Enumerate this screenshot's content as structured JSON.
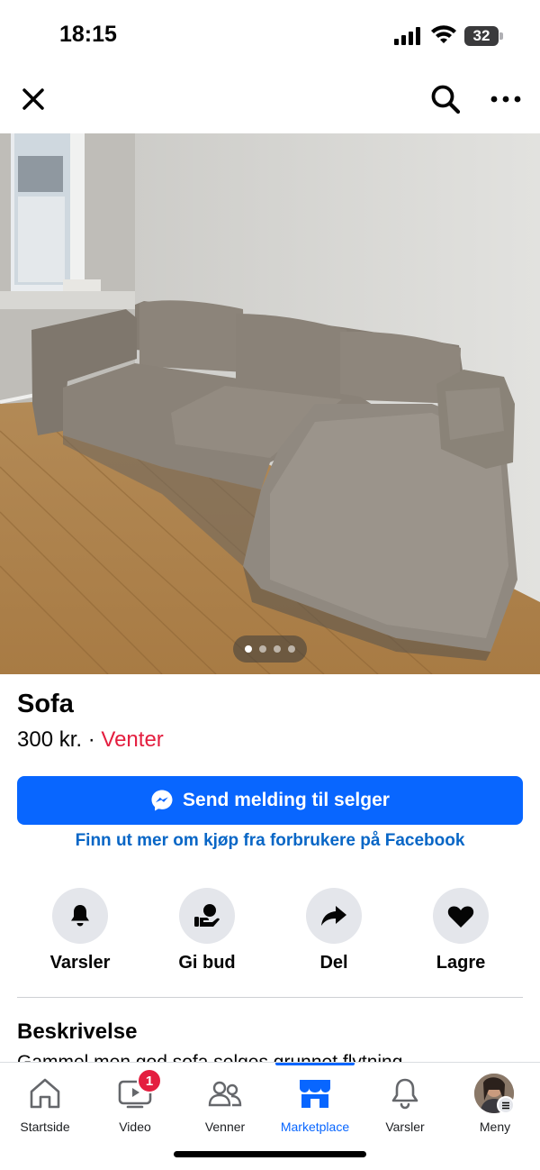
{
  "status_bar": {
    "time": "18:15",
    "battery": "32"
  },
  "top_nav": {
    "close_icon": "close-icon",
    "search_icon": "search-icon",
    "more_icon": "more-icon"
  },
  "photo": {
    "description_icon": "sofa-photo",
    "page_count": 4,
    "current_page": 1
  },
  "listing": {
    "title": "Sofa",
    "price": "300 kr.",
    "separator": "·",
    "status": "Venter",
    "status_color": "#e41e3f"
  },
  "primary_button": {
    "label": "Send melding til selger",
    "icon": "messenger-icon",
    "color": "#0866ff"
  },
  "learn_more_link": "Finn ut mer om kjøp fra forbrukere på Facebook",
  "actions": [
    {
      "label": "Varsler",
      "icon": "bell-icon"
    },
    {
      "label": "Gi bud",
      "icon": "offer-icon"
    },
    {
      "label": "Del",
      "icon": "share-icon"
    },
    {
      "label": "Lagre",
      "icon": "heart-icon"
    }
  ],
  "description": {
    "heading": "Beskrivelse",
    "text": "Gammel men god sofa selges grunnet flytning"
  },
  "tab_bar": {
    "tabs": [
      {
        "label": "Startside",
        "icon": "home-icon"
      },
      {
        "label": "Video",
        "icon": "video-icon",
        "badge": "1"
      },
      {
        "label": "Venner",
        "icon": "friends-icon"
      },
      {
        "label": "Marketplace",
        "icon": "marketplace-icon",
        "active": true
      },
      {
        "label": "Varsler",
        "icon": "bell-icon"
      },
      {
        "label": "Meny",
        "icon": "avatar"
      }
    ],
    "active_color": "#0866ff"
  }
}
